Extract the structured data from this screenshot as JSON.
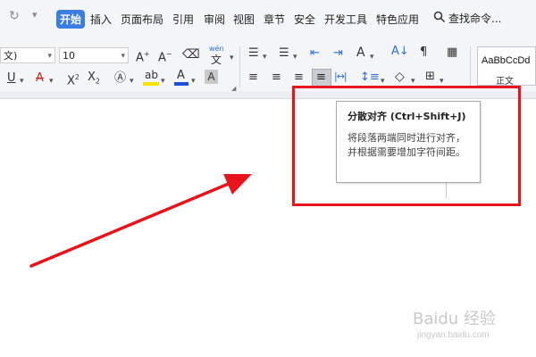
{
  "tabs": [
    "开始",
    "插入",
    "页面布局",
    "引用",
    "审阅",
    "视图",
    "章节",
    "安全",
    "开发工具",
    "特色应用"
  ],
  "search": {
    "label": "查找命令..."
  },
  "font": {
    "name": "文)",
    "size": "10"
  },
  "toolbar_labels": {
    "wen_top": "wén",
    "wen_char": "文"
  },
  "style_gallery": {
    "sample": "AaBbCcDd",
    "name": "正文"
  },
  "tooltip": {
    "title": "分散对齐 (Ctrl+Shift+J)",
    "desc": "将段落两端同时进行对齐，并根据需要增加字符间距。"
  },
  "watermark": {
    "main": "Baidu 经验",
    "url": "jingyan.baidu.com"
  },
  "colors": {
    "accent": "#3b7de0",
    "annotation": "#e8141b",
    "font_color_bar": "#1f4fd8",
    "highlight_bar": "#f5e400",
    "strike_color": "#cc2222"
  },
  "icons": [
    "redo-icon",
    "customize-quick-access-icon",
    "search-icon",
    "grow-font-icon",
    "shrink-font-icon",
    "clear-format-icon",
    "phonetic-guide-icon",
    "underline-icon",
    "strikethrough-icon",
    "superscript-icon",
    "subscript-icon",
    "text-effect-icon",
    "highlight-icon",
    "font-color-icon",
    "char-shading-icon",
    "bullets-icon",
    "numbering-icon",
    "decrease-indent-icon",
    "increase-indent-icon",
    "text-direction-icon",
    "sort-icon",
    "show-marks-icon",
    "align-left-icon",
    "align-center-icon",
    "align-right-icon",
    "justify-icon",
    "distributed-icon",
    "line-spacing-icon",
    "shading-icon",
    "borders-icon",
    "dialog-launcher-icon"
  ]
}
